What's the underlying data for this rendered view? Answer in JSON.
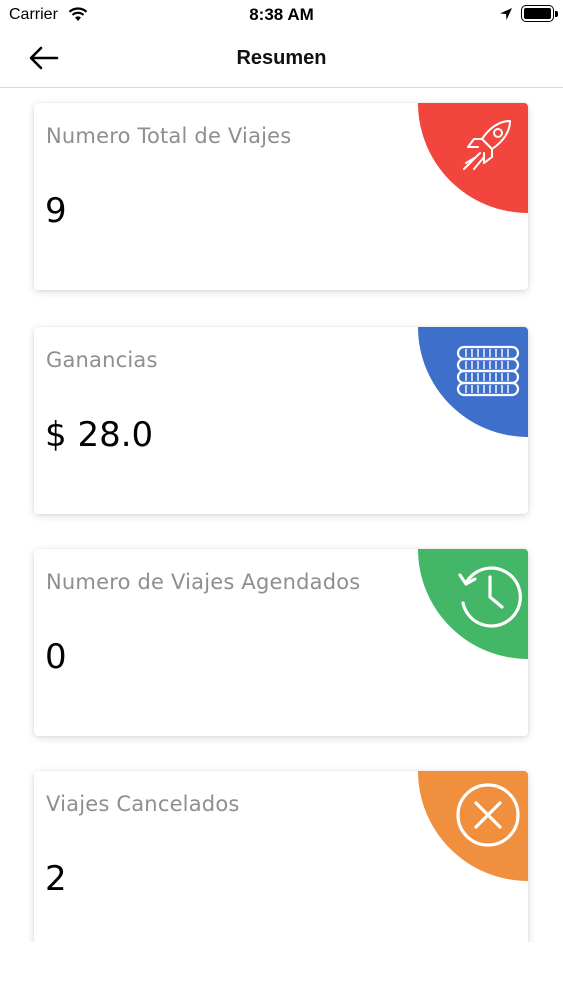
{
  "status_bar": {
    "carrier": "Carrier",
    "time": "8:38 AM"
  },
  "nav": {
    "title": "Resumen",
    "back_icon": "arrow-left-icon"
  },
  "cards": [
    {
      "label": "Numero Total de Viajes",
      "value": "9",
      "icon": "rocket-icon",
      "color": "#F2453D"
    },
    {
      "label": "Ganancias",
      "value": "$ 28.0",
      "icon": "coins-icon",
      "color": "#3E6FCB"
    },
    {
      "label": "Numero de Viajes Agendados",
      "value": "0",
      "icon": "history-clock-icon",
      "color": "#43B767"
    },
    {
      "label": "Viajes Cancelados",
      "value": "2",
      "icon": "cancel-circle-icon",
      "color": "#F08F3E"
    }
  ]
}
